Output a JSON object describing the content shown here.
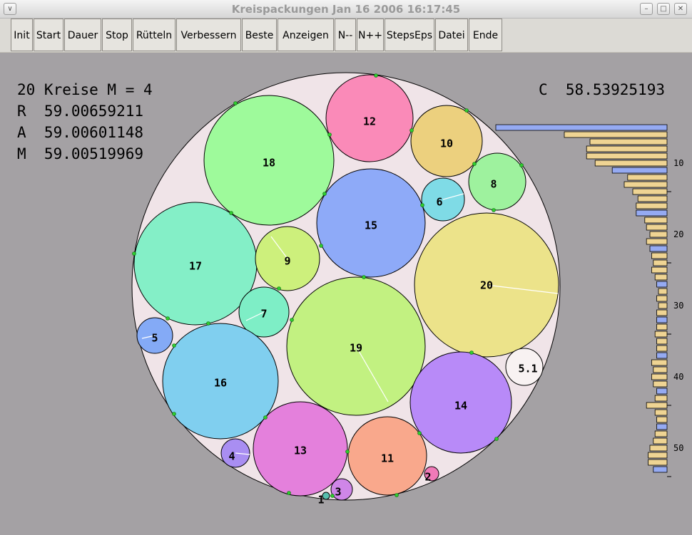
{
  "window": {
    "title": "Kreispackungen Jan 16 2006  16:17:45"
  },
  "toolbar": {
    "buttons": [
      "Init",
      "Start",
      "Dauer",
      "Stop",
      "Rütteln",
      "Verbessern",
      "Beste",
      "Anzeigen",
      "N--",
      "N++",
      "StepsEps",
      "Datei",
      "Ende"
    ]
  },
  "info": {
    "line1": "20 Kreise M = 4",
    "r": "R  59.00659211",
    "a": "A  59.00601148",
    "m": "M  59.00519969",
    "c": "C  58.53925193"
  },
  "circle_labels": [
    "18",
    "12",
    "10",
    "8",
    "6",
    "15",
    "17",
    "9",
    "20",
    "7",
    "5",
    "19",
    "16",
    "5.1",
    "14",
    "13",
    "11",
    "4",
    "2",
    "3",
    "1"
  ],
  "circle_colors": {
    "c1": "#57bfae",
    "c2": "#f07ab8",
    "c3": "#cf86e8",
    "c4": "#a98ef2",
    "c5": "#84aaf6",
    "c51": "#f8f2f2",
    "c6": "#7fdbe6",
    "c7": "#7eeec6",
    "c8": "#9ef29e",
    "c9": "#cdf07c",
    "c10": "#ecd07e",
    "c11": "#f9a88c",
    "c12": "#fa8ab8",
    "c13": "#e480dc",
    "c14": "#b88af8",
    "c15": "#8eaaf8",
    "c16": "#80cfef",
    "c17": "#84efc7",
    "c18": "#9efa9b",
    "c19": "#c2f181",
    "c20": "#ece38a"
  },
  "histogram": {
    "ticks": [
      "10",
      "20",
      "30",
      "40",
      "50"
    ],
    "bars": [
      {
        "v": 1.0,
        "c": "blue"
      },
      {
        "v": 0.6,
        "c": "tan"
      },
      {
        "v": 0.45,
        "c": "tan"
      },
      {
        "v": 0.47,
        "c": "tan"
      },
      {
        "v": 0.47,
        "c": "tan"
      },
      {
        "v": 0.42,
        "c": "tan"
      },
      {
        "v": 0.32,
        "c": "blue"
      },
      {
        "v": 0.23,
        "c": "tan"
      },
      {
        "v": 0.25,
        "c": "tan"
      },
      {
        "v": 0.2,
        "c": "tan"
      },
      {
        "v": 0.17,
        "c": "tan"
      },
      {
        "v": 0.18,
        "c": "tan"
      },
      {
        "v": 0.18,
        "c": "blue"
      },
      {
        "v": 0.13,
        "c": "tan"
      },
      {
        "v": 0.12,
        "c": "tan"
      },
      {
        "v": 0.1,
        "c": "tan"
      },
      {
        "v": 0.12,
        "c": "tan"
      },
      {
        "v": 0.1,
        "c": "blue"
      },
      {
        "v": 0.09,
        "c": "tan"
      },
      {
        "v": 0.08,
        "c": "tan"
      },
      {
        "v": 0.09,
        "c": "tan"
      },
      {
        "v": 0.07,
        "c": "tan"
      },
      {
        "v": 0.06,
        "c": "blue"
      },
      {
        "v": 0.05,
        "c": "tan"
      },
      {
        "v": 0.06,
        "c": "tan"
      },
      {
        "v": 0.05,
        "c": "tan"
      },
      {
        "v": 0.06,
        "c": "tan"
      },
      {
        "v": 0.06,
        "c": "blue"
      },
      {
        "v": 0.06,
        "c": "tan"
      },
      {
        "v": 0.07,
        "c": "tan"
      },
      {
        "v": 0.06,
        "c": "tan"
      },
      {
        "v": 0.06,
        "c": "tan"
      },
      {
        "v": 0.06,
        "c": "blue"
      },
      {
        "v": 0.09,
        "c": "tan"
      },
      {
        "v": 0.08,
        "c": "tan"
      },
      {
        "v": 0.09,
        "c": "tan"
      },
      {
        "v": 0.08,
        "c": "tan"
      },
      {
        "v": 0.06,
        "c": "blue"
      },
      {
        "v": 0.07,
        "c": "tan"
      },
      {
        "v": 0.12,
        "c": "tan"
      },
      {
        "v": 0.07,
        "c": "tan"
      },
      {
        "v": 0.06,
        "c": "tan"
      },
      {
        "v": 0.06,
        "c": "blue"
      },
      {
        "v": 0.07,
        "c": "tan"
      },
      {
        "v": 0.08,
        "c": "tan"
      },
      {
        "v": 0.1,
        "c": "tan"
      },
      {
        "v": 0.11,
        "c": "tan"
      },
      {
        "v": 0.11,
        "c": "tan"
      },
      {
        "v": 0.08,
        "c": "blue"
      }
    ],
    "colors": {
      "blue": "#95aaf2",
      "tan": "#efd493"
    }
  }
}
